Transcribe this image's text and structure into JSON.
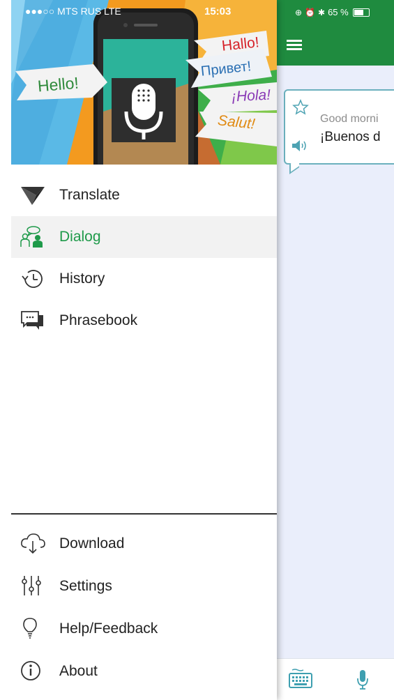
{
  "status_bar": {
    "carrier": "●●●○○ MTS RUS  LTE",
    "time": "15:03",
    "battery": "65 %"
  },
  "header_bubbles": {
    "hello": "Hello!",
    "hallo": "Hallo!",
    "privet": "Привет!",
    "hola": "¡Hola!",
    "salut": "Salut!"
  },
  "drawer": {
    "top_items": [
      {
        "label": "Translate",
        "icon": "translate-logo-icon"
      },
      {
        "label": "Dialog",
        "icon": "dialog-people-icon",
        "active": true
      },
      {
        "label": "History",
        "icon": "history-clock-icon"
      },
      {
        "label": "Phrasebook",
        "icon": "phrasebook-chat-icon"
      }
    ],
    "bottom_items": [
      {
        "label": "Download",
        "icon": "cloud-download-icon"
      },
      {
        "label": "Settings",
        "icon": "sliders-icon"
      },
      {
        "label": "Help/Feedback",
        "icon": "lightbulb-icon"
      },
      {
        "label": "About",
        "icon": "info-icon"
      }
    ]
  },
  "dialog": {
    "source_text": "Good morni",
    "target_text": "¡Buenos d"
  },
  "colors": {
    "brand_green": "#1f8b3f",
    "active_green": "#1f9a4a",
    "card_border": "#6bb0bd",
    "app_background": "#eaeefb"
  }
}
